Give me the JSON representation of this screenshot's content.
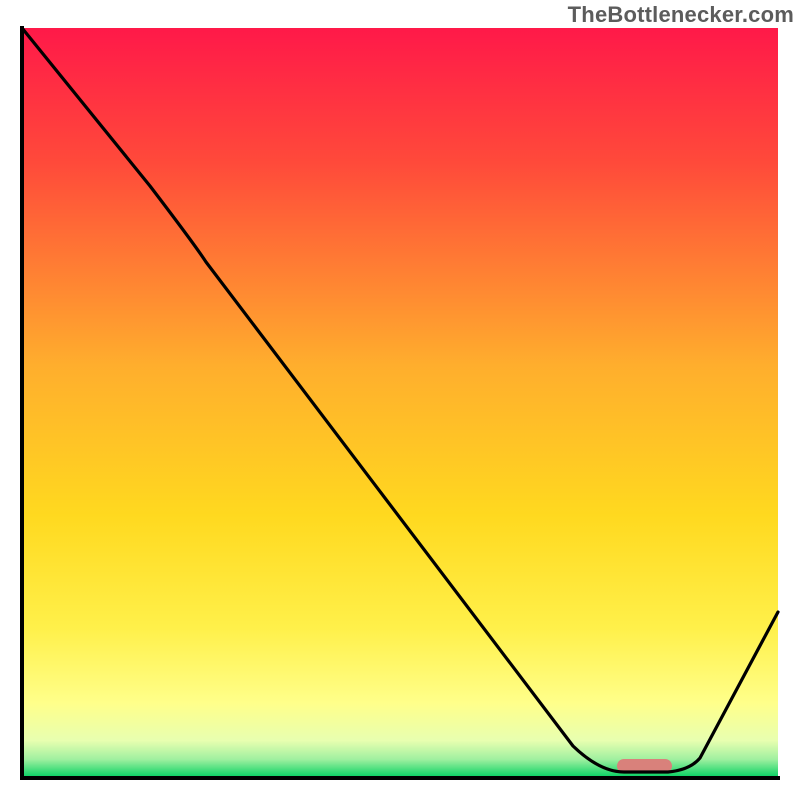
{
  "attribution": "TheBottlenecker.com",
  "chart_data": {
    "type": "line",
    "title": "",
    "xlabel": "",
    "ylabel": "",
    "xlim": [
      0,
      100
    ],
    "ylim": [
      0,
      100
    ],
    "grid": false,
    "legend": false,
    "x": [
      0,
      17,
      24.5,
      73,
      78,
      84,
      100
    ],
    "values": [
      100,
      79,
      70,
      4,
      1,
      1,
      22
    ],
    "background_gradient": {
      "top": "#ff1949",
      "mid": "#ffd700",
      "low": "#ffff80",
      "base": "#00d060"
    },
    "marker": {
      "x": 81,
      "y": 1.5,
      "width": 6.5,
      "height": 1.6,
      "color": "#d9817b"
    },
    "frame_color": "#000000"
  }
}
